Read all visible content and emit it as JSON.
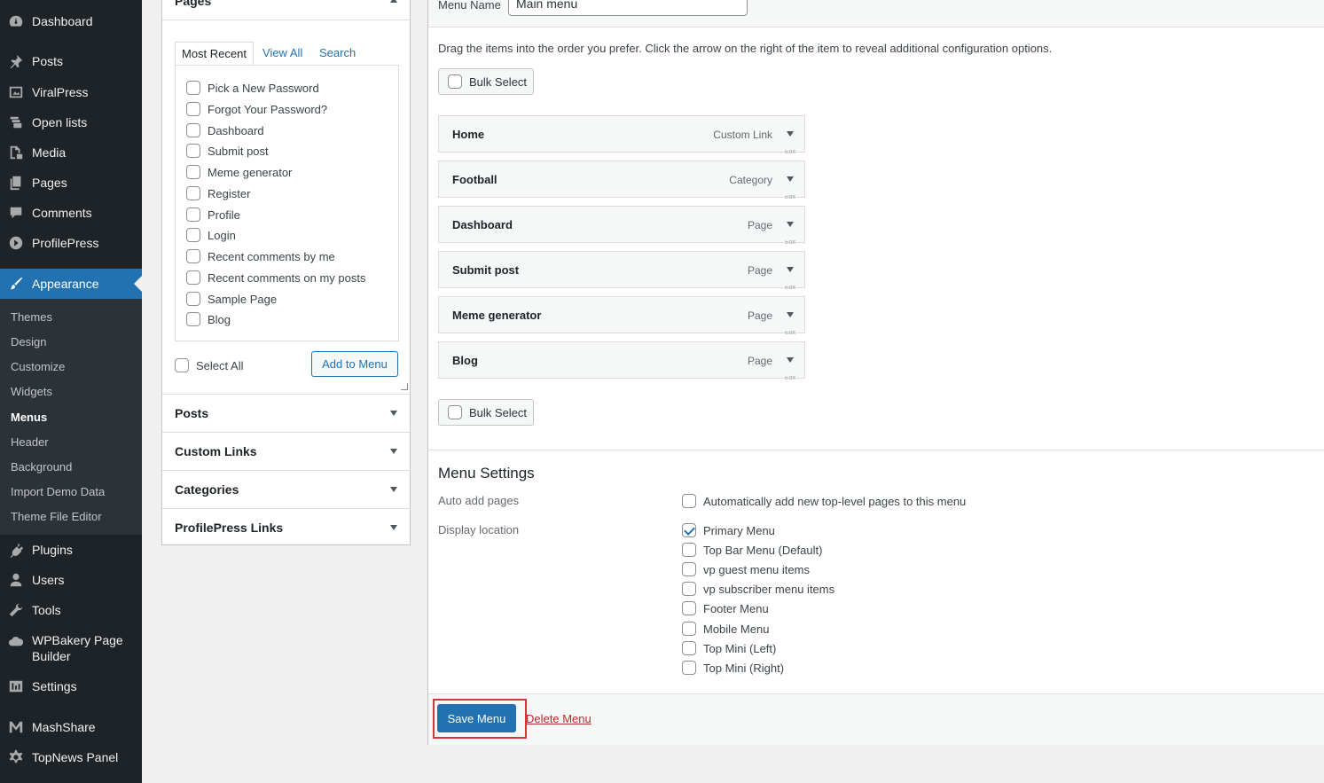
{
  "sidebar": {
    "items": [
      {
        "label": "Dashboard",
        "icon": "dashboard-icon"
      },
      {
        "label": "Posts",
        "icon": "pin-icon"
      },
      {
        "label": "ViralPress",
        "icon": "photo-icon"
      },
      {
        "label": "Open lists",
        "icon": "lists-icon"
      },
      {
        "label": "Media",
        "icon": "media-icon"
      },
      {
        "label": "Pages",
        "icon": "page-icon"
      },
      {
        "label": "Comments",
        "icon": "comment-icon"
      },
      {
        "label": "ProfilePress",
        "icon": "profilepress-icon"
      },
      {
        "label": "Appearance",
        "icon": "brush-icon"
      },
      {
        "label": "Plugins",
        "icon": "plugin-icon"
      },
      {
        "label": "Users",
        "icon": "user-icon"
      },
      {
        "label": "Tools",
        "icon": "wrench-icon"
      },
      {
        "label": "WPBakery Page",
        "label2": "Builder",
        "icon": "cloud-icon"
      },
      {
        "label": "Settings",
        "icon": "settings-icon"
      },
      {
        "label": "MashShare",
        "icon": "mashshare-icon"
      },
      {
        "label": "TopNews Panel",
        "icon": "gear-icon"
      }
    ],
    "submenu": [
      "Themes",
      "Design",
      "Customize",
      "Widgets",
      "Menus",
      "Header",
      "Background",
      "Import Demo Data",
      "Theme File Editor"
    ],
    "active_color": "#2271b1"
  },
  "pages_box": {
    "title": "Pages",
    "tabs": [
      "Most Recent",
      "View All",
      "Search"
    ],
    "items": [
      "Pick a New Password",
      "Forgot Your Password?",
      "Dashboard",
      "Submit post",
      "Meme generator",
      "Register",
      "Profile",
      "Login",
      "Recent comments by me",
      "Recent comments on my posts",
      "Sample Page",
      "Blog"
    ],
    "select_all": "Select All",
    "add_button": "Add to Menu"
  },
  "accordions": [
    "Posts",
    "Custom Links",
    "Categories",
    "ProfilePress Links"
  ],
  "menu_editor": {
    "menu_name_label": "Menu Name",
    "menu_name_value": "Main menu",
    "instructions": "Drag the items into the order you prefer. Click the arrow on the right of the item to reveal additional configuration options.",
    "bulk_select": "Bulk Select",
    "items": [
      {
        "title": "Home",
        "type": "Custom Link"
      },
      {
        "title": "Football",
        "type": "Category"
      },
      {
        "title": "Dashboard",
        "type": "Page"
      },
      {
        "title": "Submit post",
        "type": "Page"
      },
      {
        "title": "Meme generator",
        "type": "Page"
      },
      {
        "title": "Blog",
        "type": "Page"
      }
    ],
    "edit_hint": "Edit"
  },
  "menu_settings": {
    "title": "Menu Settings",
    "auto_add_label": "Auto add pages",
    "auto_add_option": "Automatically add new top-level pages to this menu",
    "display_location_label": "Display location",
    "locations": [
      {
        "label": "Primary Menu",
        "checked": true
      },
      {
        "label": "Top Bar Menu (Default)",
        "checked": false
      },
      {
        "label": "vp guest menu items",
        "checked": false
      },
      {
        "label": "vp subscriber menu items",
        "checked": false
      },
      {
        "label": "Footer Menu",
        "checked": false
      },
      {
        "label": "Mobile Menu",
        "checked": false
      },
      {
        "label": "Top Mini (Left)",
        "checked": false
      },
      {
        "label": "Top Mini (Right)",
        "checked": false
      }
    ]
  },
  "footer": {
    "save_button": "Save Menu",
    "delete_link": "Delete Menu"
  }
}
